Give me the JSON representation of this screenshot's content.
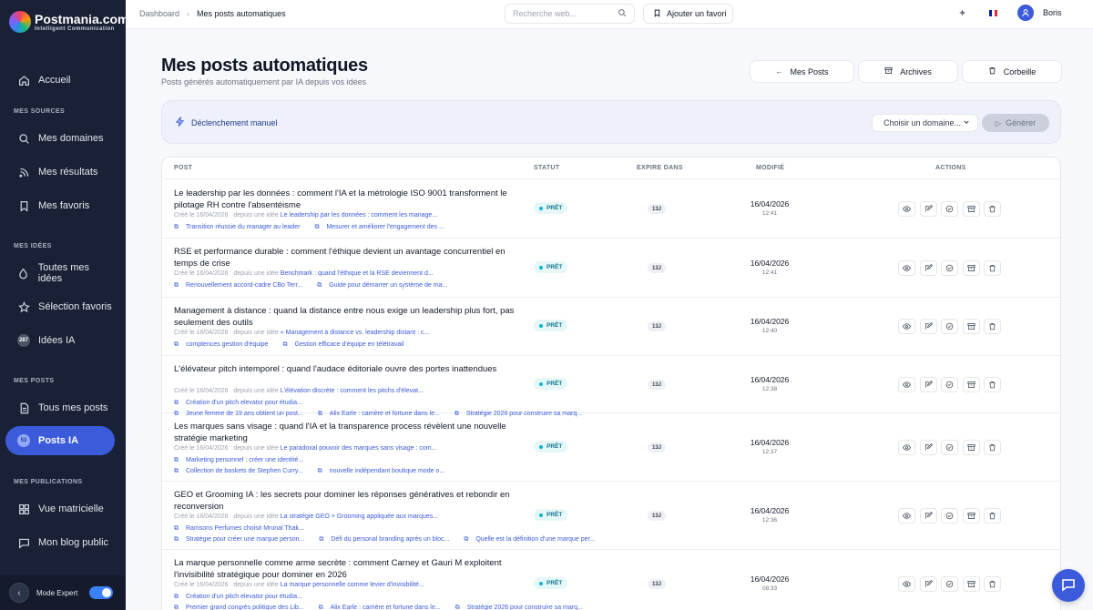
{
  "brand": {
    "name": "Postmania.com",
    "tagline": "Intelligent Communication"
  },
  "sidebar": {
    "home": "Accueil",
    "sources_title": "MES SOURCES",
    "sources": [
      "Mes domaines",
      "Mes résultats",
      "Mes favoris"
    ],
    "ideas_title": "MES IDÉES",
    "ideas": [
      "Toutes mes idées",
      "Sélection favoris",
      "Idées IA"
    ],
    "ideas_ia_badge": "287",
    "posts_title": "MES POSTS",
    "posts": [
      "Tous mes posts",
      "Posts IA"
    ],
    "posts_ia_badge": "53",
    "publications_title": "MES PUBLICATIONS",
    "publications": [
      "Vue matricielle",
      "Mon blog public"
    ],
    "mode_label": "Mode Expert",
    "mode_expert_on": true
  },
  "topbar": {
    "breadcrumb_root": "Dashboard",
    "breadcrumb_current": "Mes posts automatiques",
    "search_placeholder": "Recherche web...",
    "fav_button": "Ajouter un favori",
    "user_name": "Boris",
    "flag_colors": [
      "#002395",
      "#ffffff",
      "#ed2939"
    ]
  },
  "header": {
    "title": "Mes posts automatiques",
    "subtitle": "Posts générés automatiquement par IA depuis vos idées",
    "btn_posts": "Mes Posts",
    "btn_archives": "Archives",
    "btn_trash": "Corbeille"
  },
  "trigger": {
    "label": "Déclenchement manuel",
    "domain_select": "Choisir un domaine...",
    "generate": "Générer"
  },
  "table": {
    "columns": [
      "POST",
      "STATUT",
      "EXPIRE DANS",
      "MODIFIÉ",
      "ACTIONS"
    ],
    "rows": [
      {
        "title": "Le leadership par les données : comment l'IA et la métrologie ISO 9001 transforment le pilotage RH contre l'absentéisme",
        "created": "Créé le 16/04/2026",
        "from": "depuis une idée",
        "idea": "Le leadership par les données : comment les manage...",
        "links": [
          "Transition réussie du manager au leader",
          "Mesurer et améliorer l'engagement des ..."
        ],
        "status": "PRÊT",
        "expire": "13J",
        "date": "16/04/2026",
        "time": "12:41"
      },
      {
        "title": "RSE et performance durable : comment l'éthique devient un avantage concurrentiel en temps de crise",
        "created": "Créé le 16/04/2026",
        "from": "depuis une idée",
        "idea": "Benchmark : quand l'éthique et la RSE deviennent d...",
        "links": [
          "Renouvellement accord-cadre CBo Terr...",
          "Guide pour démarrer un système de ma..."
        ],
        "status": "PRÊT",
        "expire": "13J",
        "date": "16/04/2026",
        "time": "12:41"
      },
      {
        "title": "Management à distance : quand la distance entre nous exige un leadership plus fort, pas seulement des outils",
        "created": "Créé le 16/04/2026",
        "from": "depuis une idée",
        "idea": "« Management à distance vs. leadership distant : c...",
        "links": [
          "comptences gestion d'équipe",
          "Gestion efficace d'équipe en télétravail"
        ],
        "status": "PRÊT",
        "expire": "13J",
        "date": "16/04/2026",
        "time": "12:40"
      },
      {
        "title": "L'élévateur pitch intemporel : quand l'audace éditoriale ouvre des portes inattendues",
        "created": "Créé le 16/04/2026",
        "from": "depuis une idée",
        "idea": "L'élévation discrète : comment les pitchs d'élevat...",
        "links": [
          "Création d'un pitch elevator pour étudia...",
          "Jeune femme de 19 ans obtient un post...",
          "Alix Earle : carrière et fortune dans le...",
          "Stratégie 2026 pour construire sa marq..."
        ],
        "status": "PRÊT",
        "expire": "13J",
        "date": "16/04/2026",
        "time": "12:38"
      },
      {
        "title": "Les marques sans visage : quand l'IA et la transparence process révèlent une nouvelle stratégie marketing",
        "created": "Créé le 16/04/2026",
        "from": "depuis une idée",
        "idea": "Le paradoxal pouvoir des marques sans visage : com...",
        "links": [
          "Marketing personnel : créer une identité...",
          "Collection de baskets de Stephen Curry...",
          "nouvelle indépendant boutique mode o..."
        ],
        "status": "PRÊT",
        "expire": "13J",
        "date": "16/04/2026",
        "time": "12:37"
      },
      {
        "title": "GEO et Grooming IA : les secrets pour dominer les réponses génératives et rebondir en reconversion",
        "created": "Créé le 16/04/2026",
        "from": "depuis une idée",
        "idea": "La stratégie GEO × Grooming appliquée aux marques...",
        "links": [
          "Ramsons Perfumes choisit Mrunal Thak...",
          "Stratégie pour créer une marque person...",
          "Défi du personal branding après un bloc...",
          "Quelle est la définition d'une marque per..."
        ],
        "status": "PRÊT",
        "expire": "13J",
        "date": "16/04/2026",
        "time": "12:36"
      },
      {
        "title": "La marque personnelle comme arme secrète : comment Carney et Gauri M exploitent l'invisibilité stratégique pour dominer en 2026",
        "created": "Créé le 16/04/2026",
        "from": "depuis une idée",
        "idea": "La marque personnelle comme levier d'invisibilité...",
        "links": [
          "Création d'un pitch elevator pour étudia...",
          "Premier grand congrès politique des Lib...",
          "Alix Earle : carrière et fortune dans le...",
          "Stratégie 2026 pour construire sa marq..."
        ],
        "status": "PRÊT",
        "expire": "13J",
        "date": "16/04/2026",
        "time": "08:33"
      }
    ]
  }
}
